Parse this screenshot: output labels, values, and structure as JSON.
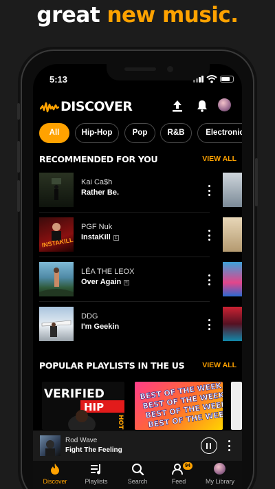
{
  "headline": {
    "word1": "great",
    "word2": "new music."
  },
  "status": {
    "time": "5:13"
  },
  "topbar": {
    "brand": "DISCOVER"
  },
  "chips": [
    "All",
    "Hip-Hop",
    "Pop",
    "R&B",
    "Electronic"
  ],
  "recommended": {
    "title": "RECOMMENDED FOR YOU",
    "view_all": "VIEW ALL",
    "tracks": [
      {
        "artist": "Kai Ca$h",
        "title": "Rather Be.",
        "explicit": false
      },
      {
        "artist": "PGF Nuk",
        "title": "InstaKill",
        "explicit": true
      },
      {
        "artist": "LÉA THE LEOX",
        "title": "Over Again",
        "explicit": true
      },
      {
        "artist": "DDG",
        "title": "I'm Geekin",
        "explicit": false
      }
    ],
    "explicit_mark": "E"
  },
  "playlists": {
    "title": "POPULAR PLAYLISTS IN THE US",
    "view_all": "VIEW ALL",
    "cover1_text": [
      "VERIFIED",
      "HIP"
    ],
    "cover1_side": "HOT",
    "cover2_text": [
      "BEST OF THE WEEK",
      "BEST OF THE WEEK",
      "BEST OF THE WEEK",
      "BEST OF THE WEEK"
    ]
  },
  "cover_text": {
    "instakill": "INSTAKILL"
  },
  "player": {
    "artist": "Rod Wave",
    "title": "Fight The Feeling"
  },
  "tabs": [
    {
      "label": "Discover",
      "icon": "flame-icon",
      "active": true
    },
    {
      "label": "Playlists",
      "icon": "playlist-icon",
      "active": false
    },
    {
      "label": "Search",
      "icon": "search-icon",
      "active": false
    },
    {
      "label": "Feed",
      "icon": "feed-icon",
      "active": false,
      "badge": "94"
    },
    {
      "label": "My Library",
      "icon": "avatar-icon",
      "active": false
    }
  ],
  "colors": {
    "accent": "#ffa200",
    "background": "#000000"
  }
}
